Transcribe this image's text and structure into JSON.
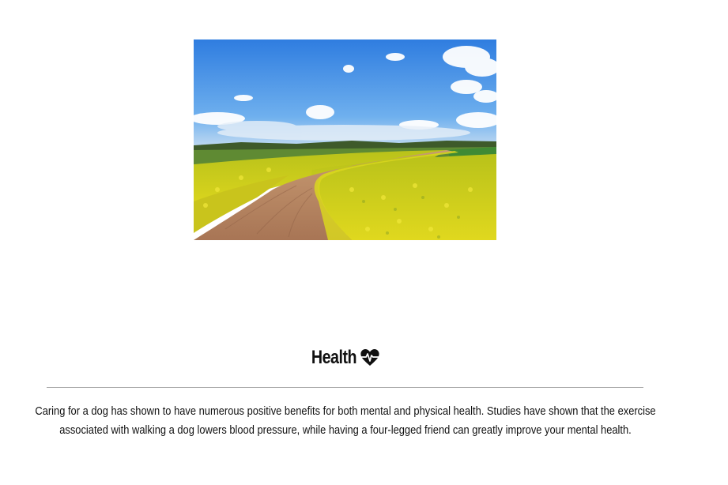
{
  "hero_image": {
    "subject": "landscape-photo-rapeseed-field-with-dirt-path",
    "colors": {
      "sky_top": "#3f86dd",
      "sky_bottom": "#a9cdf0",
      "field_yellow": "#d8d21a",
      "field_green": "#4f8a2a",
      "path_brown": "#b98663"
    }
  },
  "section": {
    "title": "Health",
    "title_icon": "heartbeat-icon",
    "body": "Caring for a dog has shown to have numerous positive benefits for both mental and physical health. Studies have shown that the exercise associated with walking a dog lowers blood pressure, while having a four-legged friend can greatly improve your mental health."
  },
  "colors": {
    "text": "#111111",
    "divider": "#a8a8a8",
    "background": "#ffffff"
  }
}
